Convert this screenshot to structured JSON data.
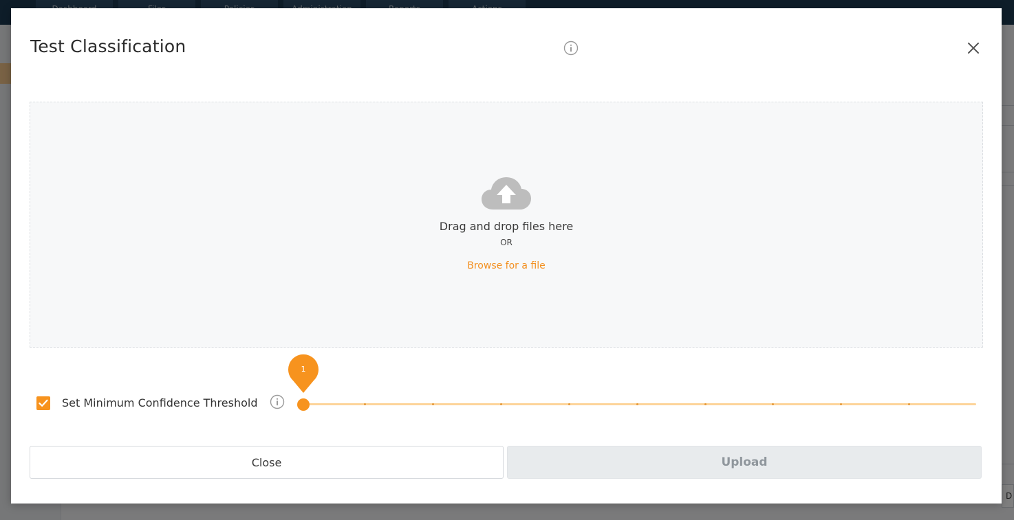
{
  "background": {
    "nav_tabs": [
      "Dashboard",
      "Files",
      "Policies",
      "Administration",
      "Reports",
      "Actions"
    ],
    "footer_text": "D"
  },
  "modal": {
    "title": "Test Classification",
    "title_info_icon": "info-circle-icon",
    "close_icon": "close-x-icon"
  },
  "dropzone": {
    "icon": "cloud-upload-icon",
    "text": "Drag and drop files here",
    "or_text": "OR",
    "browse_label": "Browse for a file"
  },
  "threshold": {
    "checkbox_checked": true,
    "label": "Set Minimum Confidence Threshold",
    "info_icon": "info-circle-icon",
    "value": "1",
    "min": 1,
    "max": 10
  },
  "buttons": {
    "close_label": "Close",
    "upload_label": "Upload",
    "upload_disabled": true
  },
  "colors": {
    "accent": "#f7931e",
    "link": "#f39021",
    "track": "#fdd49a",
    "upload_disabled_bg": "#e8ebed",
    "top_bar": "#1d3a52"
  }
}
